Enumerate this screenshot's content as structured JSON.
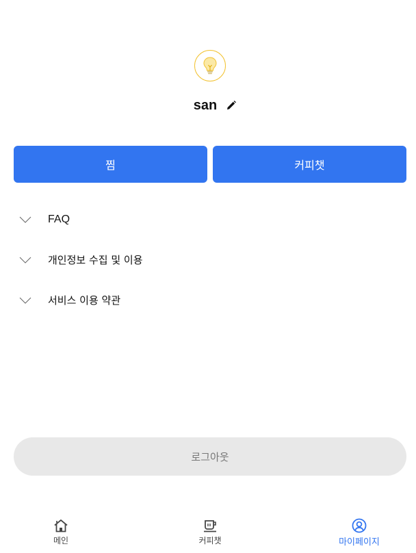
{
  "profile": {
    "username": "san",
    "avatar_icon": "lightbulb-icon",
    "edit_icon": "pencil-icon"
  },
  "actions": {
    "favorites_label": "찜",
    "coffee_chat_label": "커피챗"
  },
  "accordion": [
    {
      "label": "FAQ",
      "icon": "chevron-down-icon"
    },
    {
      "label": "개인정보 수집 및 이용",
      "icon": "chevron-down-icon"
    },
    {
      "label": "서비스 이용 약관",
      "icon": "chevron-down-icon"
    }
  ],
  "logout_label": "로그아웃",
  "nav": {
    "items": [
      {
        "label": "메인",
        "icon": "home-icon"
      },
      {
        "label": "커피챗",
        "icon": "coffee-cup-icon"
      },
      {
        "label": "마이페이지",
        "icon": "user-circle-icon"
      }
    ],
    "active": "마이페이지"
  },
  "colors": {
    "primary": "#3275f0",
    "avatar_border": "#f2c230",
    "logout_bg": "#e8e8e8"
  }
}
